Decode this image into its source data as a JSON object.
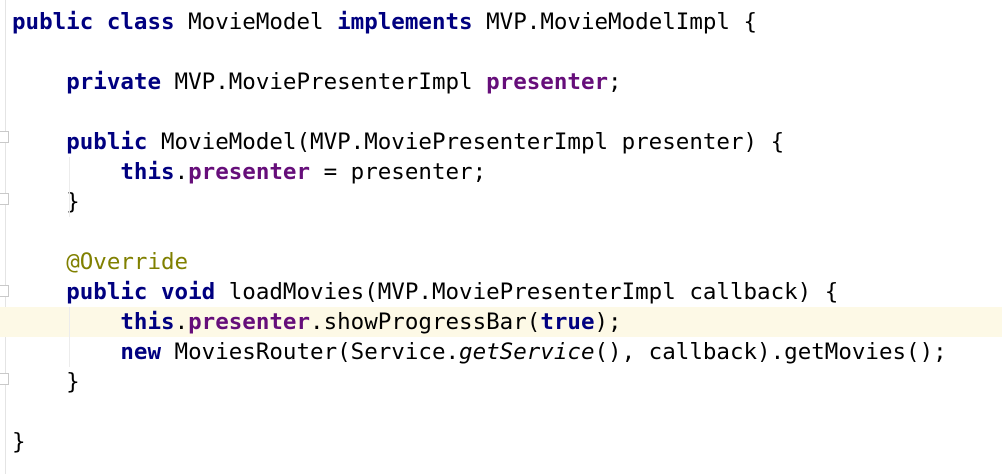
{
  "editor": {
    "background": "#ffffff",
    "highlight_color": "#fdf9e6",
    "keyword_color": "#000080",
    "field_color": "#660e7a",
    "annotation_color": "#808000",
    "lines": [
      [
        {
          "t": "public",
          "c": "kw"
        },
        {
          "t": " "
        },
        {
          "t": "class",
          "c": "kw"
        },
        {
          "t": " MovieModel "
        },
        {
          "t": "implements",
          "c": "kw"
        },
        {
          "t": " MVP.MovieModelImpl {"
        }
      ],
      [],
      [
        {
          "t": "    "
        },
        {
          "t": "private",
          "c": "kw"
        },
        {
          "t": " MVP.MoviePresenterImpl "
        },
        {
          "t": "presenter",
          "c": "fld"
        },
        {
          "t": ";"
        }
      ],
      [],
      [
        {
          "t": "    "
        },
        {
          "t": "public",
          "c": "kw"
        },
        {
          "t": " MovieModel(MVP.MoviePresenterImpl presenter) {"
        }
      ],
      [
        {
          "t": "        "
        },
        {
          "t": "this",
          "c": "kw"
        },
        {
          "t": "."
        },
        {
          "t": "presenter",
          "c": "fld"
        },
        {
          "t": " = presenter;"
        }
      ],
      [
        {
          "t": "    }"
        }
      ],
      [],
      [
        {
          "t": "    "
        },
        {
          "t": "@Override",
          "c": "ann"
        }
      ],
      [
        {
          "t": "    "
        },
        {
          "t": "public",
          "c": "kw"
        },
        {
          "t": " "
        },
        {
          "t": "void",
          "c": "kw"
        },
        {
          "t": " loadMovies(MVP.MoviePresenterImpl callback) {"
        }
      ],
      [
        {
          "t": "        "
        },
        {
          "t": "this",
          "c": "kw"
        },
        {
          "t": "."
        },
        {
          "t": "presenter",
          "c": "fld"
        },
        {
          "t": ".showProgressBar("
        },
        {
          "t": "true",
          "c": "kw"
        },
        {
          "t": ");"
        }
      ],
      [
        {
          "t": "        "
        },
        {
          "t": "new",
          "c": "kw"
        },
        {
          "t": " MoviesRouter(Service."
        },
        {
          "t": "getService",
          "c": "it"
        },
        {
          "t": "(), callback).getMovies();"
        }
      ],
      [
        {
          "t": "    }"
        }
      ],
      [],
      [
        {
          "t": "}"
        }
      ]
    ],
    "highlighted_line": 10
  }
}
